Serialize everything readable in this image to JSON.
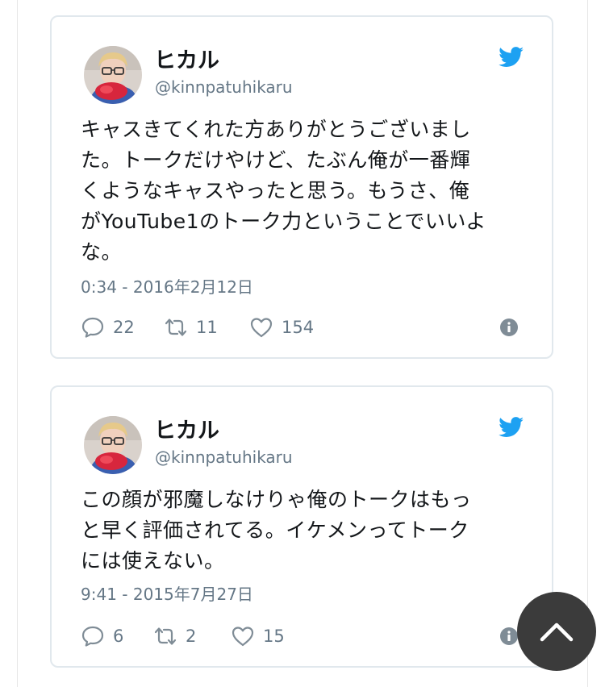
{
  "tweets": [
    {
      "name": "ヒカル",
      "handle": "@kinnpatuhikaru",
      "text": "キャスきてくれた方ありがとうございまし\nた。トークだけやけど、たぶん俺が一番輝\nくようなキャスやったと思う。もうさ、俺\nがYouTube1のトーク力ということでいいよ\nな。",
      "timestamp": "0:34 - 2016年2月12日",
      "replies": "22",
      "retweets": "11",
      "likes": "154"
    },
    {
      "name": "ヒカル",
      "handle": "@kinnpatuhikaru",
      "text": "この顔が邪魔しなけりゃ俺のトークはもっ\nと早く評価されてる。イケメンってトーク\nには使えない。",
      "timestamp": "9:41 - 2015年7月27日",
      "replies": "6",
      "retweets": "2",
      "likes": "15"
    }
  ],
  "icons": {
    "brand": "twitter-bird-icon",
    "reply": "reply-icon",
    "retweet": "retweet-icon",
    "like": "heart-icon",
    "info": "info-icon",
    "scroll_top": "chevron-up-icon"
  },
  "colors": {
    "twitter_blue": "#1da1f2",
    "text": "#14171a",
    "secondary_text": "#657786",
    "card_border": "#e1e8ed",
    "icon_gray": "#7f8c96",
    "scroll_button": "#3b3b3b"
  }
}
